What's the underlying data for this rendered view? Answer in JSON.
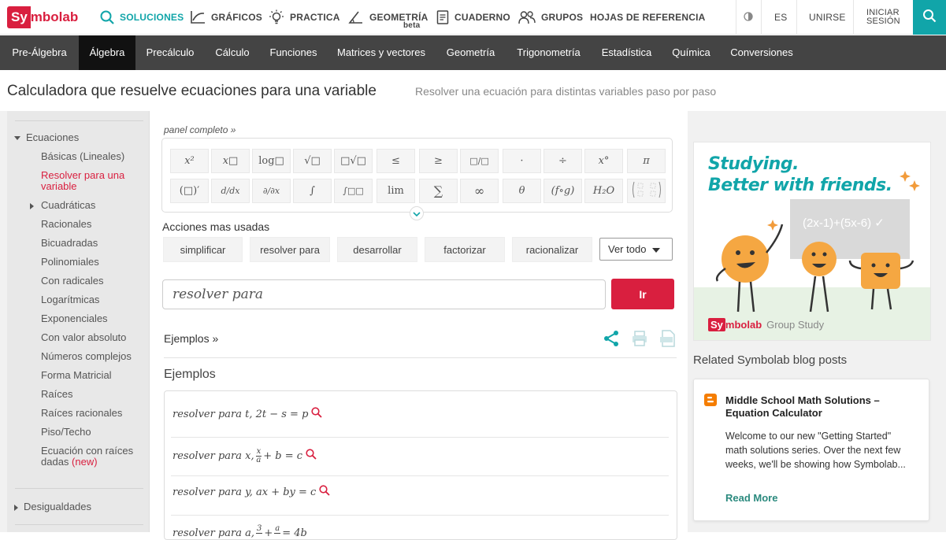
{
  "logo": {
    "part1": "Sy",
    "part2": "mbolab"
  },
  "topnav": {
    "solutions": "SOLUCIONES",
    "graphs": "GRÁFICOS",
    "practice": "PRACTICA",
    "geometry": "GEOMETRÍA",
    "geometry_badge": "beta",
    "notebook": "CUADERNO",
    "groups": "GRUPOS",
    "cheatsheets": "HOJAS DE REFERENCIA",
    "language": "ES",
    "join": "UNIRSE",
    "signin_line1": "INICIAR",
    "signin_line2": "SESIÓN"
  },
  "subnav": [
    "Pre-Álgebra",
    "Álgebra",
    "Precálculo",
    "Cálculo",
    "Funciones",
    "Matrices y vectores",
    "Geometría",
    "Trigonometría",
    "Estadística",
    "Química",
    "Conversiones"
  ],
  "page": {
    "title": "Calculadora que resuelve ecuaciones para una variable",
    "subtitle": "Resolver una ecuación para distintas variables paso por paso"
  },
  "sidebar": {
    "section1": "Ecuaciones",
    "items": [
      "Básicas (Lineales)",
      "Resolver para una variable",
      "Cuadráticas",
      "Racionales",
      "Bicuadradas",
      "Polinomiales",
      "Con radicales",
      "Logarítmicas",
      "Exponenciales",
      "Con valor absoluto",
      "Números complejos",
      "Forma Matricial",
      "Raíces",
      "Raíces racionales",
      "Piso/Techo",
      "Ecuación con raíces dadas"
    ],
    "new_badge": "(new)",
    "section2": "Desigualdades"
  },
  "main": {
    "panel_link": "panel completo »",
    "keypad_row1": [
      "x²",
      "x□",
      "log□",
      "√□",
      "□√□",
      "≤",
      "≥",
      "□/□",
      "·",
      "÷",
      "x°",
      "π"
    ],
    "keypad_row2": [
      "(□)′",
      "d/dx",
      "∂/∂x",
      "∫",
      "∫□□",
      "lim",
      "∑",
      "∞",
      "θ",
      "(f∘g)",
      "H₂O",
      "matrix"
    ],
    "actions_label": "Acciones mas usadas",
    "actions": [
      "simplificar",
      "resolver para",
      "desarrollar",
      "factorizar",
      "racionalizar"
    ],
    "see_all": "Ver todo",
    "query": "resolver para",
    "go": "Ir",
    "examples_link": "Ejemplos »",
    "examples_heading": "Ejemplos",
    "example1": "resolver para t, 2t − s = p",
    "example2_pre": "resolver para x, ",
    "example2_num": "x",
    "example2_den": "a",
    "example2_post": " + b = c",
    "example3": "resolver para y, ax + by = c",
    "example4_pre": "resolver para a, ",
    "example4_num1": "3",
    "example4_num2": "a",
    "example4_post": " = 4b"
  },
  "promo": {
    "title_line1": "Studying.",
    "title_line2": "Better with friends.",
    "board": "(2x-1)+(5x-6) ✓",
    "brand_suffix": "Group Study"
  },
  "related": {
    "heading": "Related Symbolab blog posts",
    "title": "Middle School Math Solutions – Equation Calculator",
    "body": "Welcome to our new \"Getting Started\" math solutions series. Over the next few weeks, we'll be showing how Symbolab...",
    "more": "Read More"
  },
  "colors": {
    "brand_red": "#d91f3f",
    "teal": "#11a5a9",
    "subnav_bg": "#444444"
  }
}
